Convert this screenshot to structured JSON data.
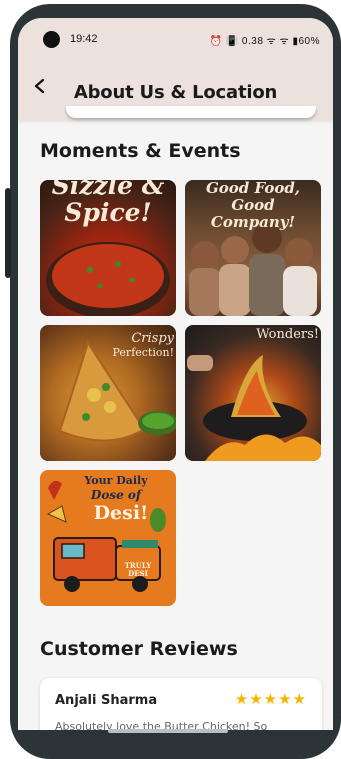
{
  "status_bar": {
    "time": "19:42",
    "icons_text": "⏰ 📳 0.38 ᯤ ᯤ ▮60%"
  },
  "app_bar": {
    "title": "About Us & Location"
  },
  "moments": {
    "title": "Moments & Events",
    "tiles": [
      {
        "caption": "Sizzle & Spice!"
      },
      {
        "caption": "Good Food, Good Company!"
      },
      {
        "caption_line1": "Crispy",
        "caption_line2": "Perfection!"
      },
      {
        "caption": "Wonders!"
      },
      {
        "caption_line1": "Your Daily",
        "caption_line2": "Dose of",
        "caption_line3": "Desi!",
        "truck_text": "TRULY DESI"
      }
    ]
  },
  "reviews": {
    "title": "Customer Reviews",
    "items": [
      {
        "name": "Anjali Sharma",
        "rating": 5,
        "stars": "★★★★★",
        "text": "Absolutely love the Butter Chicken! So"
      }
    ]
  },
  "colors": {
    "app_bar_bg": "#ece1dc",
    "screen_bg": "#f5f5f5",
    "star": "#f4b400",
    "frame": "#2b3437"
  }
}
